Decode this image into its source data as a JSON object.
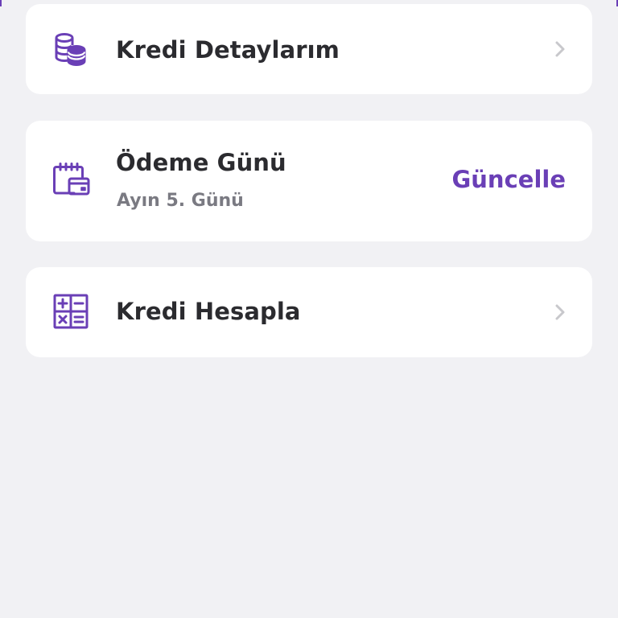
{
  "colors": {
    "accent": "#6a3fb6",
    "background": "#f1f1f4",
    "card": "#ffffff",
    "text_primary": "#2b2b2f",
    "text_secondary": "#7a7a82",
    "chevron": "#c8c8cc"
  },
  "items": [
    {
      "icon": "coins-stack-icon",
      "title": "Kredi Detaylarım"
    },
    {
      "icon": "calendar-payment-icon",
      "title": "Ödeme Günü",
      "subtitle": "Ayın 5. Günü",
      "action_label": "Güncelle"
    },
    {
      "icon": "calculator-icon",
      "title": "Kredi Hesapla"
    }
  ]
}
